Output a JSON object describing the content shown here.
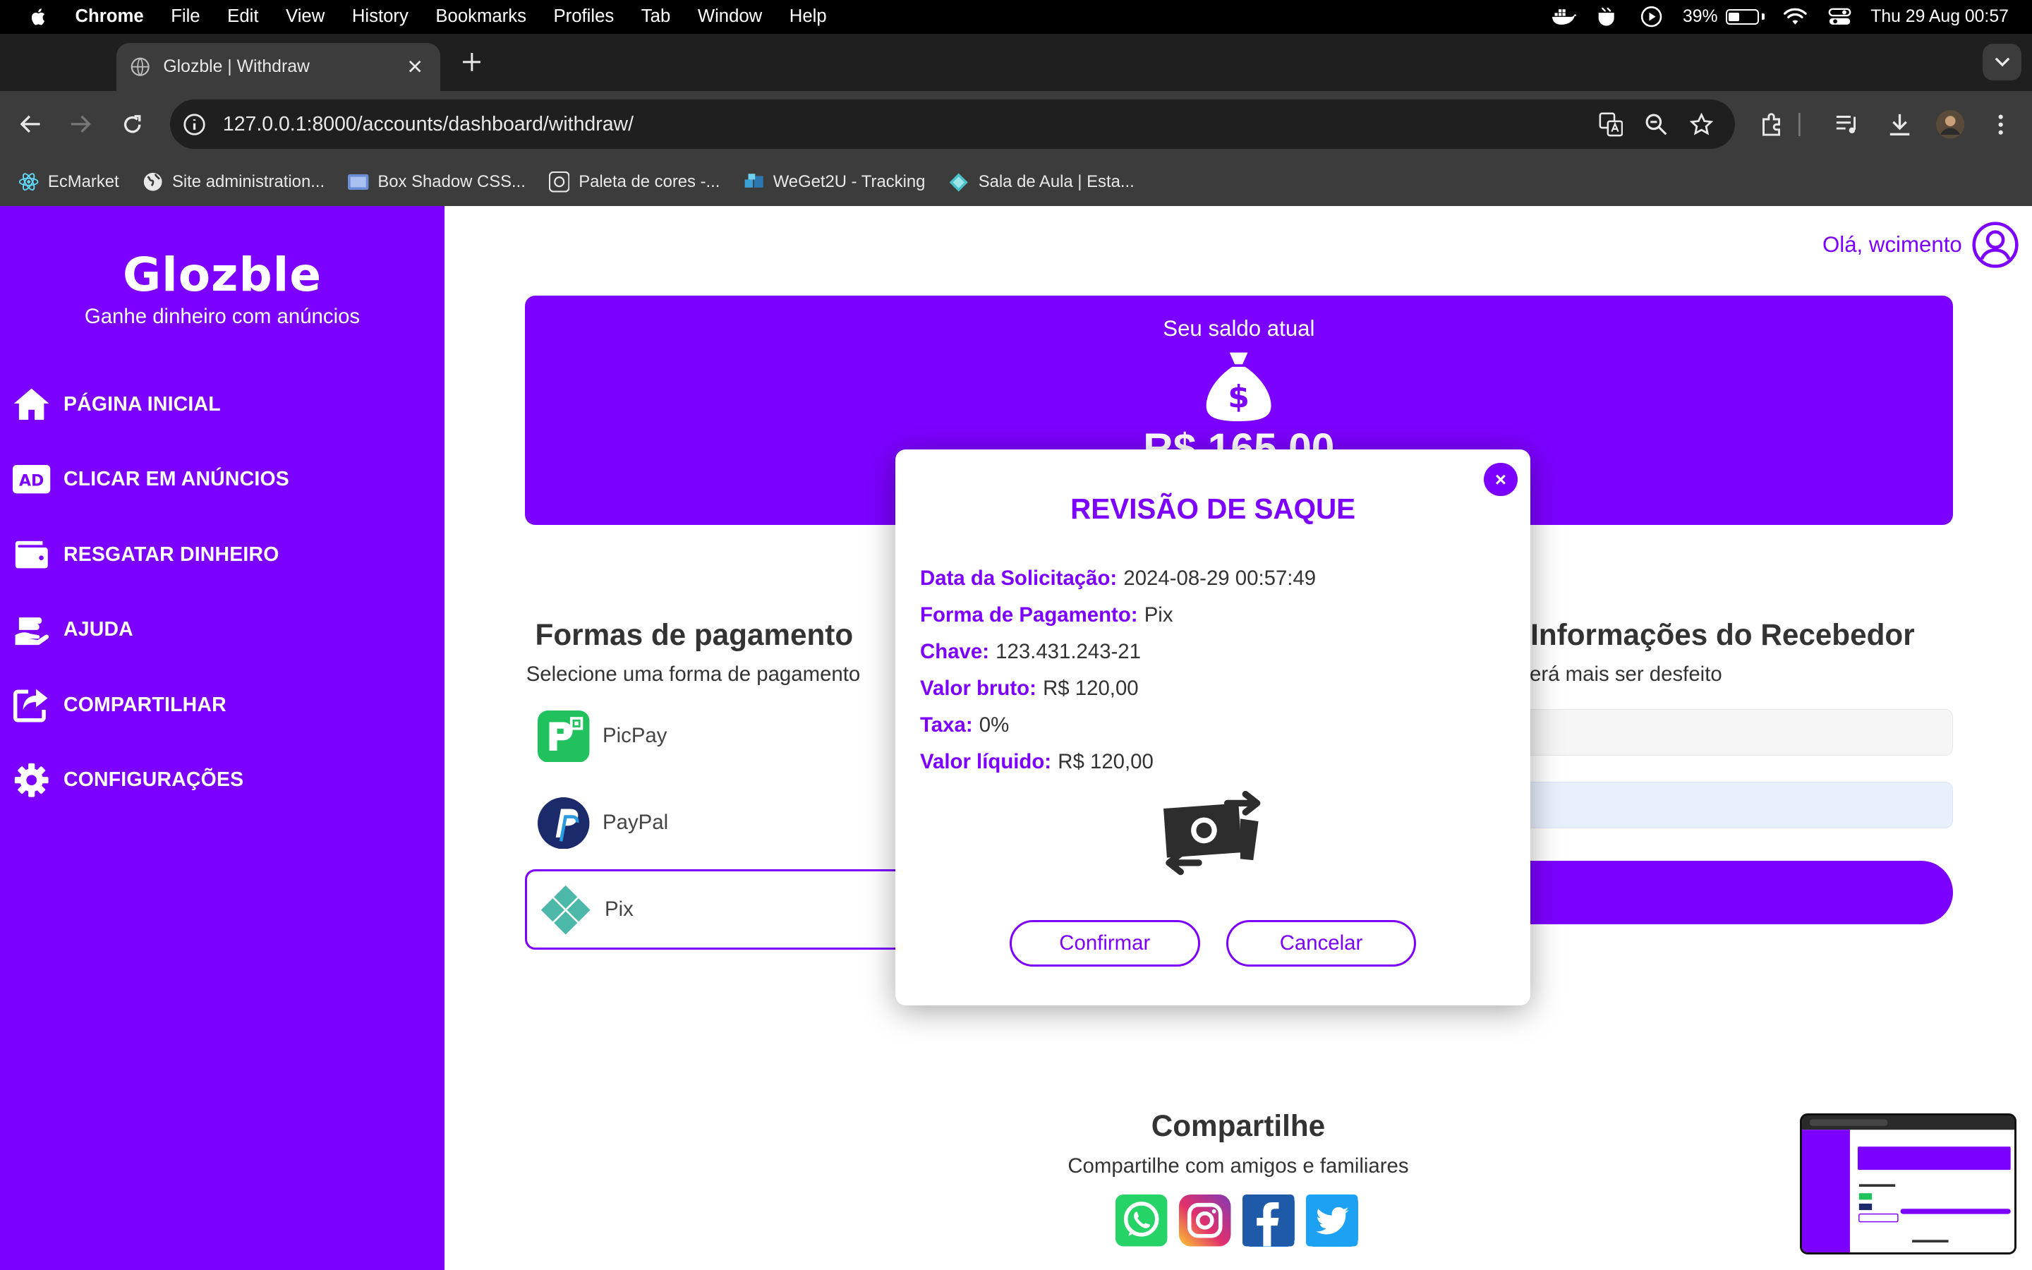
{
  "menubar": {
    "app": "Chrome",
    "items": [
      "File",
      "Edit",
      "View",
      "History",
      "Bookmarks",
      "Profiles",
      "Tab",
      "Window",
      "Help"
    ],
    "battery": "39%",
    "battery_level": 0.39,
    "clock": "Thu 29 Aug  00:57"
  },
  "browser": {
    "tab_title": "Glozble | Withdraw",
    "url": "127.0.0.1:8000/accounts/dashboard/withdraw/",
    "bookmarks": [
      {
        "label": "EcMarket",
        "icon": "react-icon"
      },
      {
        "label": "Site administration...",
        "icon": "globe-icon"
      },
      {
        "label": "Box Shadow CSS...",
        "icon": "box-icon"
      },
      {
        "label": "Paleta de cores -...",
        "icon": "palette-icon"
      },
      {
        "label": "WeGet2U - Tracking",
        "icon": "tracking-icon"
      },
      {
        "label": "Sala de Aula | Esta...",
        "icon": "diamond-icon"
      }
    ]
  },
  "sidebar": {
    "brand": "Glozble",
    "tagline": "Ganhe dinheiro com anúncios",
    "items": [
      {
        "label": "PÁGINA INICIAL",
        "icon": "home-icon"
      },
      {
        "label": "CLICAR EM ANÚNCIOS",
        "icon": "ad-icon"
      },
      {
        "label": "RESGATAR DINHEIRO",
        "icon": "wallet-icon"
      },
      {
        "label": "AJUDA",
        "icon": "hand-help-icon"
      },
      {
        "label": "COMPARTILHAR",
        "icon": "share-icon"
      },
      {
        "label": "CONFIGURAÇÕES",
        "icon": "gear-icon"
      }
    ]
  },
  "header": {
    "greeting": "Olá, wcimento"
  },
  "balance": {
    "label": "Seu saldo atual",
    "amount": "R$ 165,00"
  },
  "payment": {
    "title": "Formas de pagamento",
    "subtitle": "Selecione uma forma de pagamento",
    "methods": [
      {
        "label": "PicPay",
        "icon": "picpay-icon"
      },
      {
        "label": "PayPal",
        "icon": "paypal-icon"
      },
      {
        "label": "Pix",
        "icon": "pix-icon",
        "selected": true
      }
    ]
  },
  "receiver": {
    "title": "Informações do Recebedor",
    "subtitle": "Atenção: este processo não poderá mais ser desfeito"
  },
  "share": {
    "title": "Compartilhe",
    "subtitle": "Compartilhe com amigos e familiares",
    "networks": [
      "whatsapp-icon",
      "instagram-icon",
      "facebook-icon",
      "twitter-icon"
    ]
  },
  "modal": {
    "title": "REVISÃO DE SAQUE",
    "rows": [
      {
        "key": "Data da Solicitação:",
        "value": "2024-08-29 00:57:49"
      },
      {
        "key": "Forma de Pagamento:",
        "value": "Pix"
      },
      {
        "key": "Chave:",
        "value": "123.431.243-21"
      },
      {
        "key": "Valor bruto:",
        "value": "R$ 120,00"
      },
      {
        "key": "Taxa:",
        "value": "0%"
      },
      {
        "key": "Valor líquido:",
        "value": "R$ 120,00"
      }
    ],
    "close": "×",
    "confirm": "Confirmar",
    "cancel": "Cancelar"
  },
  "colors": {
    "brand": "#7c00ff",
    "text": "#333333"
  }
}
